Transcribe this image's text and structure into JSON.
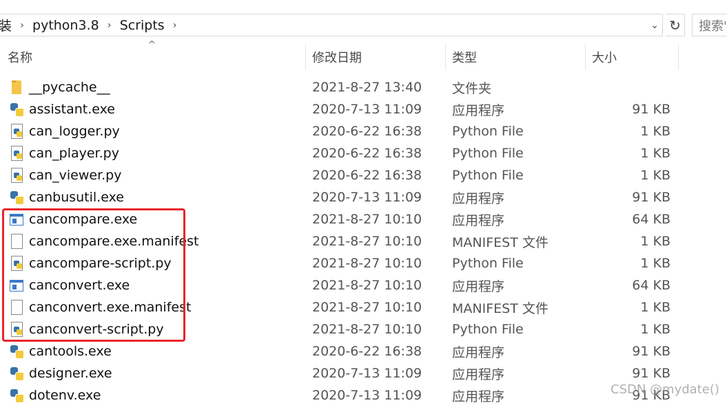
{
  "address_bar": {
    "crumbs": [
      "装",
      "python3.8",
      "Scripts"
    ],
    "separator_glyph": "›",
    "dropdown_glyph": "⌄",
    "refresh_glyph": "↻"
  },
  "search": {
    "placeholder": "搜索\""
  },
  "columns": {
    "name": "名称",
    "modified": "修改日期",
    "type": "类型",
    "size": "大小",
    "sort_glyph": "^"
  },
  "files": [
    {
      "icon": "folder-icon",
      "name": "__pycache__",
      "modified": "2021-8-27 13:40",
      "type": "文件夹",
      "size": ""
    },
    {
      "icon": "python-exe-icon",
      "name": "assistant.exe",
      "modified": "2020-7-13 11:09",
      "type": "应用程序",
      "size": "91 KB"
    },
    {
      "icon": "python-file-icon",
      "name": "can_logger.py",
      "modified": "2020-6-22 16:38",
      "type": "Python File",
      "size": "1 KB"
    },
    {
      "icon": "python-file-icon",
      "name": "can_player.py",
      "modified": "2020-6-22 16:38",
      "type": "Python File",
      "size": "1 KB"
    },
    {
      "icon": "python-file-icon",
      "name": "can_viewer.py",
      "modified": "2020-6-22 16:38",
      "type": "Python File",
      "size": "1 KB"
    },
    {
      "icon": "python-exe-icon",
      "name": "canbusutil.exe",
      "modified": "2020-7-13 11:09",
      "type": "应用程序",
      "size": "91 KB"
    },
    {
      "icon": "window-exe-icon",
      "name": "cancompare.exe",
      "modified": "2021-8-27 10:10",
      "type": "应用程序",
      "size": "64 KB"
    },
    {
      "icon": "document-icon",
      "name": "cancompare.exe.manifest",
      "modified": "2021-8-27 10:10",
      "type": "MANIFEST 文件",
      "size": "1 KB"
    },
    {
      "icon": "python-file-icon",
      "name": "cancompare-script.py",
      "modified": "2021-8-27 10:10",
      "type": "Python File",
      "size": "1 KB"
    },
    {
      "icon": "window-exe-icon",
      "name": "canconvert.exe",
      "modified": "2021-8-27 10:10",
      "type": "应用程序",
      "size": "64 KB"
    },
    {
      "icon": "document-icon",
      "name": "canconvert.exe.manifest",
      "modified": "2021-8-27 10:10",
      "type": "MANIFEST 文件",
      "size": "1 KB"
    },
    {
      "icon": "python-file-icon",
      "name": "canconvert-script.py",
      "modified": "2021-8-27 10:10",
      "type": "Python File",
      "size": "1 KB"
    },
    {
      "icon": "python-exe-icon",
      "name": "cantools.exe",
      "modified": "2020-6-22 16:38",
      "type": "应用程序",
      "size": "91 KB"
    },
    {
      "icon": "python-exe-icon",
      "name": "designer.exe",
      "modified": "2020-7-13 11:09",
      "type": "应用程序",
      "size": "91 KB"
    },
    {
      "icon": "python-exe-icon",
      "name": "dotenv.exe",
      "modified": "2020-7-13 11:09",
      "type": "应用程序",
      "size": "91 KB"
    }
  ],
  "watermark": "CSDN @mydate()",
  "colors": {
    "highlight": "#e8262b",
    "folder": "#f4c54a",
    "python_blue": "#3872a8",
    "python_yellow": "#f2cb3b"
  }
}
